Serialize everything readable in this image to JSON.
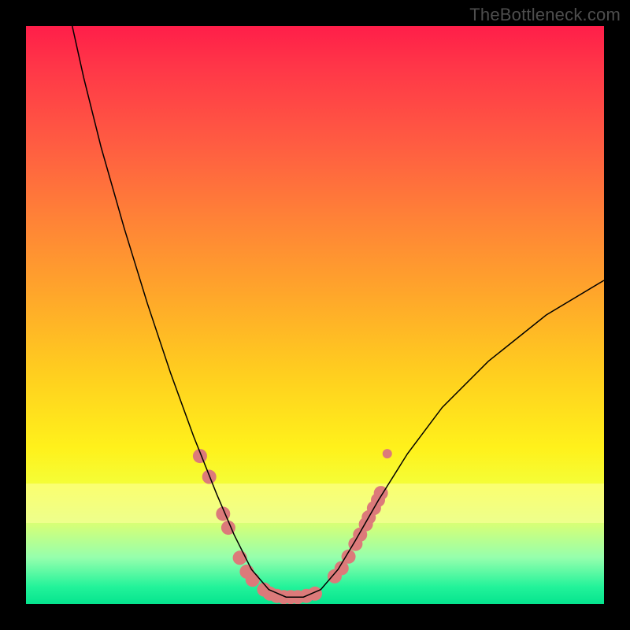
{
  "attribution": "TheBottleneck.com",
  "chart_data": {
    "type": "line",
    "title": "",
    "xlabel": "",
    "ylabel": "",
    "xlim": [
      0,
      100
    ],
    "ylim": [
      0,
      100
    ],
    "curve": {
      "name": "bottleneck-curve",
      "color": "#000000",
      "width": 1.5,
      "points": [
        {
          "x": 8.0,
          "y": 100.0
        },
        {
          "x": 10.0,
          "y": 91.0
        },
        {
          "x": 13.0,
          "y": 79.0
        },
        {
          "x": 17.0,
          "y": 65.0
        },
        {
          "x": 21.0,
          "y": 52.0
        },
        {
          "x": 25.0,
          "y": 40.0
        },
        {
          "x": 29.0,
          "y": 29.0
        },
        {
          "x": 33.0,
          "y": 19.0
        },
        {
          "x": 36.0,
          "y": 12.0
        },
        {
          "x": 39.0,
          "y": 6.0
        },
        {
          "x": 42.0,
          "y": 2.5
        },
        {
          "x": 45.0,
          "y": 1.2
        },
        {
          "x": 48.0,
          "y": 1.2
        },
        {
          "x": 51.0,
          "y": 2.5
        },
        {
          "x": 54.0,
          "y": 6.0
        },
        {
          "x": 57.0,
          "y": 11.0
        },
        {
          "x": 61.0,
          "y": 18.0
        },
        {
          "x": 66.0,
          "y": 26.0
        },
        {
          "x": 72.0,
          "y": 34.0
        },
        {
          "x": 80.0,
          "y": 42.0
        },
        {
          "x": 90.0,
          "y": 50.0
        },
        {
          "x": 100.0,
          "y": 56.0
        }
      ]
    },
    "left_markers": {
      "color": "#DC7A7A",
      "radius": 9,
      "points": [
        {
          "x": 30.1,
          "y": 25.6
        },
        {
          "x": 31.7,
          "y": 22.0
        },
        {
          "x": 34.1,
          "y": 15.6
        },
        {
          "x": 35.0,
          "y": 13.2
        },
        {
          "x": 37.0,
          "y": 8.0
        },
        {
          "x": 38.2,
          "y": 5.6
        },
        {
          "x": 39.2,
          "y": 4.2
        },
        {
          "x": 41.2,
          "y": 2.5
        },
        {
          "x": 42.2,
          "y": 1.8
        },
        {
          "x": 43.4,
          "y": 1.4
        },
        {
          "x": 44.6,
          "y": 1.2
        },
        {
          "x": 45.8,
          "y": 1.2
        },
        {
          "x": 47.0,
          "y": 1.2
        },
        {
          "x": 48.5,
          "y": 1.4
        },
        {
          "x": 50.0,
          "y": 1.8
        }
      ]
    },
    "right_markers": {
      "color": "#DC7A7A",
      "radius": 9,
      "points": [
        {
          "x": 53.4,
          "y": 4.8
        },
        {
          "x": 54.6,
          "y": 6.2
        },
        {
          "x": 55.8,
          "y": 8.2
        },
        {
          "x": 57.0,
          "y": 10.4
        },
        {
          "x": 57.8,
          "y": 12.0
        },
        {
          "x": 58.8,
          "y": 13.8
        },
        {
          "x": 59.3,
          "y": 15.0
        },
        {
          "x": 60.2,
          "y": 16.6
        },
        {
          "x": 60.9,
          "y": 18.0
        },
        {
          "x": 61.4,
          "y": 19.2
        }
      ]
    },
    "right_single_marker": {
      "color": "#DC7A7A",
      "radius": 6,
      "point": {
        "x": 62.5,
        "y": 26.0
      }
    },
    "yellow_band": {
      "y_from": 13,
      "y_to": 20
    }
  }
}
